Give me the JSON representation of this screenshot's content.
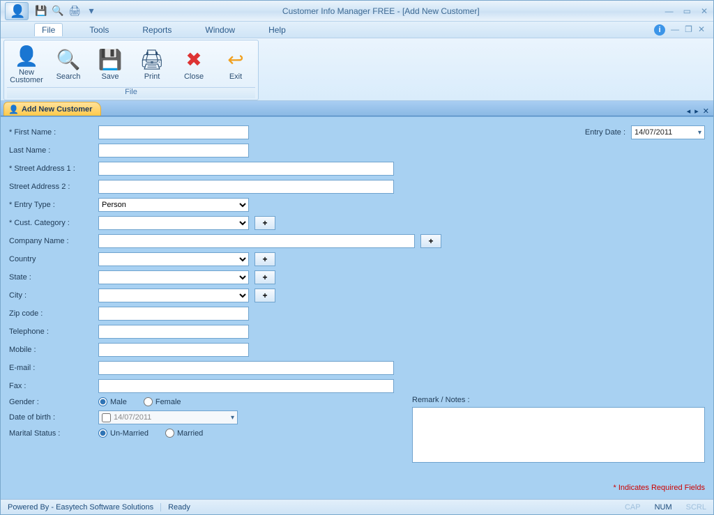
{
  "title": "Customer Info Manager FREE - [Add New Customer]",
  "menu": {
    "file": "File",
    "tools": "Tools",
    "reports": "Reports",
    "window": "Window",
    "help": "Help"
  },
  "ribbon": {
    "group_label": "File",
    "buttons": {
      "new_customer": "New Customer",
      "search": "Search",
      "save": "Save",
      "print": "Print",
      "close": "Close",
      "exit": "Exit"
    }
  },
  "tab": {
    "label": "Add New Customer"
  },
  "form": {
    "labels": {
      "first_name": "* First Name :",
      "last_name": "Last Name :",
      "street1": "* Street Address 1 :",
      "street2": "Street Address 2 :",
      "entry_type": "* Entry Type :",
      "cust_category": "* Cust. Category :",
      "company": "Company Name :",
      "country": "Country",
      "state": "State :",
      "city": "City :",
      "zip": "Zip code :",
      "telephone": "Telephone :",
      "mobile": "Mobile :",
      "email": "E-mail :",
      "fax": "Fax :",
      "gender": "Gender :",
      "dob": "Date of birth :",
      "marital": "Marital Status :",
      "remark": "Remark / Notes :",
      "entry_date": "Entry Date :"
    },
    "values": {
      "first_name": "",
      "last_name": "",
      "street1": "",
      "street2": "",
      "entry_type": "Person",
      "cust_category": "",
      "company": "",
      "country": "",
      "state": "",
      "city": "",
      "zip": "",
      "telephone": "",
      "mobile": "",
      "email": "",
      "fax": "",
      "dob": "14/07/2011",
      "entry_date": "14/07/2011",
      "remark": ""
    },
    "radios": {
      "gender_male": "Male",
      "gender_female": "Female",
      "marital_un": "Un-Married",
      "marital_m": "Married"
    },
    "plus": "+",
    "required_note": "* Indicates Required Fields"
  },
  "status": {
    "powered": "Powered By - Easytech Software Solutions",
    "ready": "Ready",
    "cap": "CAP",
    "num": "NUM",
    "scrl": "SCRL"
  }
}
